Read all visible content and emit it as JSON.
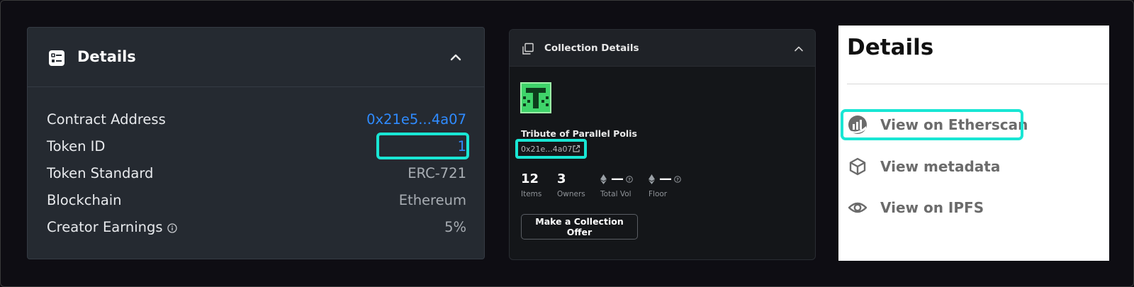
{
  "panel1": {
    "title": "Details",
    "rows": [
      {
        "label": "Contract Address",
        "value": "0x21e5...4a07"
      },
      {
        "label": "Token ID",
        "value": "1"
      },
      {
        "label": "Token Standard",
        "value": "ERC-721"
      },
      {
        "label": "Blockchain",
        "value": "Ethereum"
      },
      {
        "label": "Creator Earnings",
        "value": "5%"
      }
    ],
    "icons": [
      "details-list-icon",
      "chevron-up-icon",
      "info-icon"
    ],
    "colors": {
      "background": "#252a31",
      "link": "#2f8bff",
      "highlight": "#19e6d4"
    }
  },
  "panel2": {
    "title": "Collection Details",
    "collection_name": "Tribute of Parallel Polis",
    "address": "0x21e...4a07",
    "stats": [
      {
        "value": "12",
        "caption": "Items"
      },
      {
        "value": "3",
        "caption": "Owners"
      },
      {
        "value": "—",
        "caption": "Total Vol"
      },
      {
        "value": "—",
        "caption": "Floor"
      }
    ],
    "button_label": "Make a Collection Offer",
    "icons": [
      "collection-icon",
      "chevron-up-icon",
      "external-link-icon",
      "eth-icon",
      "help-icon"
    ],
    "colors": {
      "background": "#141619",
      "logo": "#3fd46a"
    }
  },
  "panel3": {
    "title": "Details",
    "links": [
      {
        "label": "View on Etherscan",
        "icon": "etherscan-icon"
      },
      {
        "label": "View metadata",
        "icon": "cube-icon"
      },
      {
        "label": "View on IPFS",
        "icon": "eye-icon"
      }
    ]
  }
}
